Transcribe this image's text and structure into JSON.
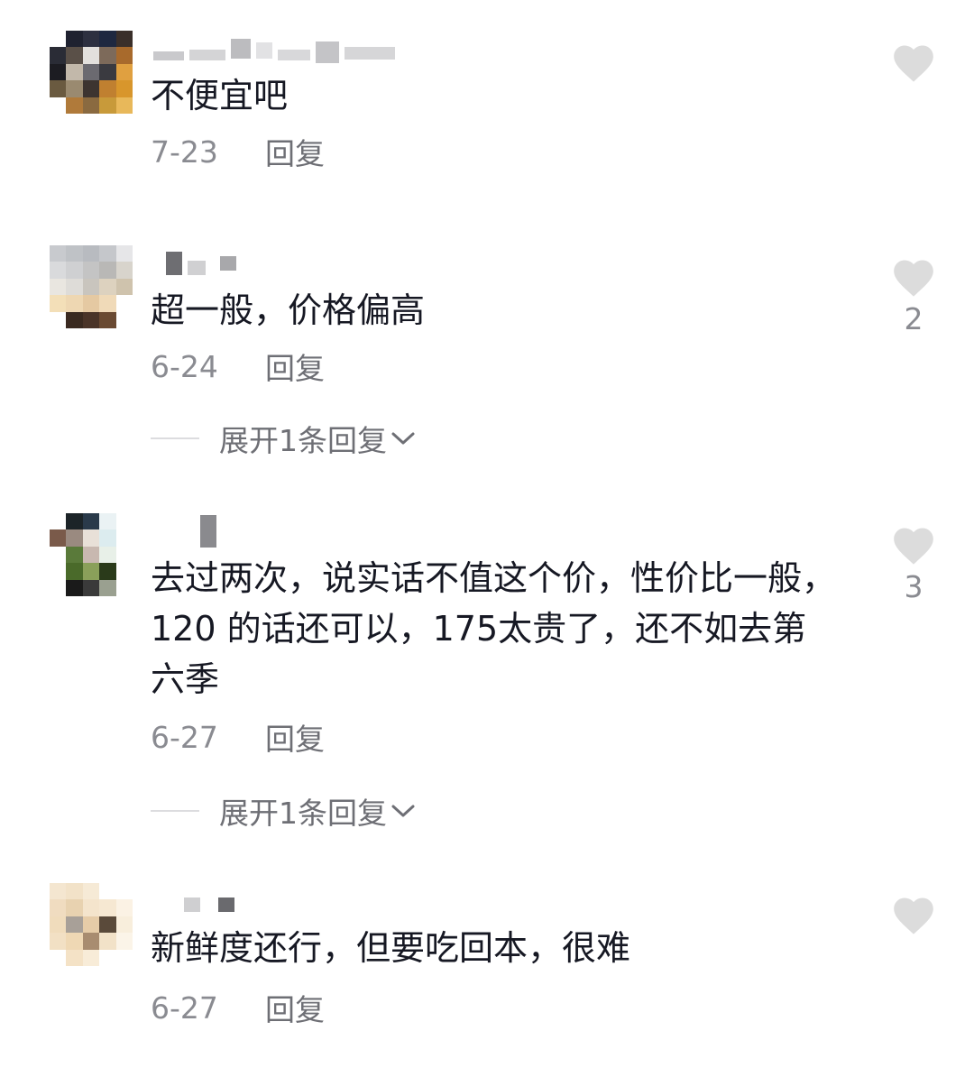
{
  "colors": {
    "text": "#161823",
    "meta": "#8a8b91",
    "heart": "#dcdcdc",
    "divider": "#dcdcdf"
  },
  "icons": {
    "like": "heart-icon",
    "expand": "chevron-down-icon"
  },
  "comments": [
    {
      "text": "不便宜吧",
      "date": "7-23",
      "reply_label": "回复",
      "likes": "",
      "avatar_pixels": [
        "#ffffff",
        "#1f2230",
        "#2d3040",
        "#1e2840",
        "#3a2f2a",
        "#2a2c36",
        "#5a5048",
        "#e3e0dc",
        "#7d6a5a",
        "#a86a2c",
        "#1c1c22",
        "#c2b8aa",
        "#6b6a70",
        "#3a3a40",
        "#e0a040",
        "#6a5a40",
        "#9a8a70",
        "#3d3430",
        "#c08030",
        "#d8962c",
        "#ffffff",
        "#b07a3a",
        "#8a6a40",
        "#c89a3a",
        "#e8b85a"
      ]
    },
    {
      "text": "超一般，价格偏高",
      "date": "6-24",
      "reply_label": "回复",
      "likes": "2",
      "expand_label": "展开1条回复",
      "avatar_pixels": [
        "#c8cace",
        "#bfc2c6",
        "#b8bbc0",
        "#c5c7cb",
        "#e6e6e8",
        "#d9dadc",
        "#cfd0d2",
        "#c4c4c4",
        "#b9b8b6",
        "#d8d4cc",
        "#e9e6e0",
        "#dedcd8",
        "#c9c5be",
        "#ddd2bf",
        "#cfc3ad",
        "#f3dfb8",
        "#eed7b2",
        "#e5c9a2",
        "#f0dab8",
        "#ffffff",
        "#ffffff",
        "#3a2a20",
        "#4a3428",
        "#6a4a32",
        "#ffffff"
      ]
    },
    {
      "text": "去过两次，说实话不值这个价，性价比一般，120 的话还可以，175太贵了，还不如去第六季",
      "date": "6-27",
      "reply_label": "回复",
      "likes": "3",
      "expand_label": "展开1条回复",
      "avatar_pixels": [
        "#ffffff",
        "#1c2428",
        "#2a3a4a",
        "#eaf2f4",
        "#ffffff",
        "#7a5a4a",
        "#9a8a80",
        "#e8e0d8",
        "#dcecef",
        "#ffffff",
        "#ffffff",
        "#5a7a3a",
        "#c8b8b0",
        "#e8f0e8",
        "#ffffff",
        "#ffffff",
        "#4a6a2a",
        "#8aa05a",
        "#2a3a1a",
        "#ffffff",
        "#ffffff",
        "#1a1a1a",
        "#3a3a3a",
        "#9aa090",
        "#ffffff"
      ]
    },
    {
      "text": "新鲜度还行，但要吃回本，很难",
      "date": "6-27",
      "reply_label": "回复",
      "likes": "",
      "avatar_pixels": [
        "#f4e6d0",
        "#f2e2c8",
        "#f6ead6",
        "#ffffff",
        "#ffffff",
        "#f0dcc0",
        "#e8d2b0",
        "#f4e4cc",
        "#f6e8d2",
        "#fbf2e4",
        "#f0dcbc",
        "#a8a098",
        "#e6cca8",
        "#5a4a3a",
        "#f8eedc",
        "#f2e0c4",
        "#efd8b4",
        "#a88c70",
        "#f2e2c8",
        "#fbf4e8",
        "#ffffff",
        "#f4e2c6",
        "#f8ecd8",
        "#ffffff",
        "#ffffff"
      ]
    }
  ]
}
